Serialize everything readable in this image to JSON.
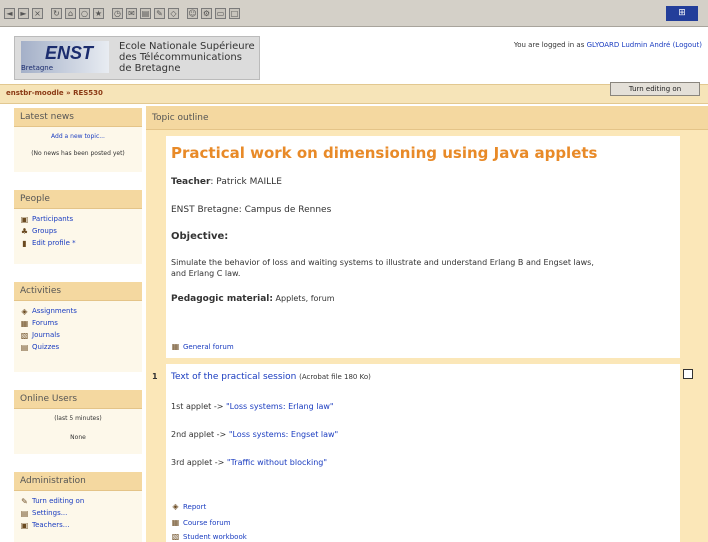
{
  "header": {
    "school_lines": [
      "Ecole Nationale Supérieure",
      "des Télécommunications",
      "de Bretagne"
    ],
    "logo_text": "ENST",
    "logo_sub": "Bretagne",
    "login_prefix": "You are logged in as",
    "login_user": "GLYOARD Ludmin André",
    "logout": "(Logout)"
  },
  "nav": {
    "crumb_root": "enstbr-moodle",
    "crumb_sep": "»",
    "crumb_course": "RES530",
    "edit_button": "Turn editing on"
  },
  "sidebar": {
    "latest_news": {
      "title": "Latest news",
      "add_topic": "Add a new topic...",
      "empty": "(No news has been posted yet)"
    },
    "people": {
      "title": "People",
      "items": [
        {
          "icon": "users-icon",
          "label": "Participants"
        },
        {
          "icon": "groups-icon",
          "label": "Groups"
        },
        {
          "icon": "profile-icon",
          "label": "Edit profile *"
        }
      ]
    },
    "activities": {
      "title": "Activities",
      "items": [
        {
          "icon": "assignment-icon",
          "label": "Assignments"
        },
        {
          "icon": "forum-icon",
          "label": "Forums"
        },
        {
          "icon": "journal-icon",
          "label": "Journals"
        },
        {
          "icon": "quiz-icon",
          "label": "Quizzes"
        }
      ]
    },
    "online_users": {
      "title": "Online Users",
      "period": "(last 5 minutes)",
      "none": "None"
    },
    "administration": {
      "title": "Administration",
      "items": [
        {
          "icon": "edit-icon",
          "label": "Turn editing on"
        },
        {
          "icon": "settings-icon",
          "label": "Settings..."
        },
        {
          "icon": "teachers-icon",
          "label": "Teachers..."
        }
      ]
    }
  },
  "main": {
    "outline_title": "Topic outline",
    "section0": {
      "heading": "Practical work on dimensioning using Java applets",
      "teacher_label": "Teacher",
      "teacher_name": ": Patrick MAILLE",
      "campus": "ENST Bretagne: Campus de Rennes",
      "objective_label": "Objective:",
      "objective_text_1": "Simulate the behavior of loss and waiting systems to illustrate and understand Erlang B and Engset laws,",
      "objective_text_2": "and Erlang C law.",
      "material_label": "Pedagogic material:",
      "material_text": " Applets, forum",
      "forum_link": "General forum"
    },
    "section1": {
      "number": "1",
      "session_link": "Text of the practical session",
      "session_note": "(Acrobat file 180 Ko)",
      "applets": [
        {
          "prefix": "1st applet  ->",
          "link": "\"Loss systems: Erlang law\""
        },
        {
          "prefix": "2nd applet  ->",
          "link": "\"Loss systems: Engset law\""
        },
        {
          "prefix": "3rd applet  ->",
          "link": "\"Traffic without blocking\""
        }
      ],
      "resources": [
        {
          "icon": "report-icon",
          "label": "Report"
        },
        {
          "icon": "forum-icon",
          "label": "Course forum"
        },
        {
          "icon": "workbook-icon",
          "label": "Student workbook"
        }
      ]
    }
  }
}
